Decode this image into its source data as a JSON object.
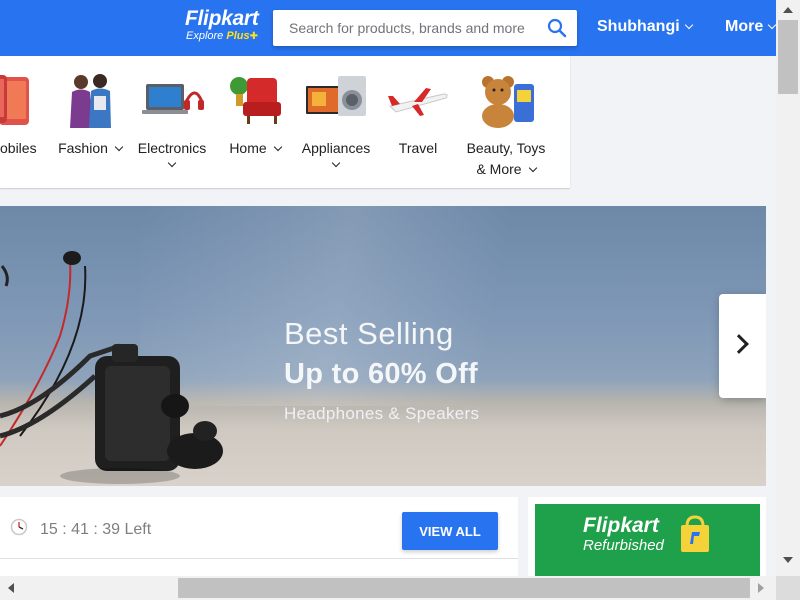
{
  "header": {
    "logo_main": "Flipkart",
    "logo_sub_prefix": "Explore",
    "logo_sub_plus": "Plus",
    "search_placeholder": "Search for products, brands and more",
    "search_icon": "search-icon",
    "user_name": "Shubhangi",
    "more_label": "More",
    "brand_color": "#2874f0",
    "plus_color": "#ffe11b"
  },
  "categories": [
    {
      "label": "Mobiles",
      "shown_text": "obiles",
      "icon": "mobile-phone-icon",
      "has_dropdown": false
    },
    {
      "label": "Fashion",
      "icon": "fashion-models-icon",
      "has_dropdown": true
    },
    {
      "label": "Electronics",
      "icon": "laptop-headphones-icon",
      "has_dropdown": true
    },
    {
      "label": "Home",
      "icon": "armchair-icon",
      "has_dropdown": true
    },
    {
      "label": "Appliances",
      "icon": "tv-washing-machine-icon",
      "has_dropdown": true
    },
    {
      "label": "Travel",
      "icon": "airplane-icon",
      "has_dropdown": false
    },
    {
      "label_line1": "Beauty, Toys",
      "label_line2": "& More",
      "icon": "teddy-bear-icon",
      "has_dropdown": true
    }
  ],
  "banner": {
    "line1": "Best Selling",
    "line2": "Up to 60% Off",
    "line3": "Headphones & Speakers",
    "next_icon": "chevron-right-icon"
  },
  "deals": {
    "timer": "15 : 41 : 39 Left",
    "timer_icon": "timer-clock-icon",
    "view_all_label": "VIEW ALL"
  },
  "refurbished": {
    "title": "Flipkart",
    "subtitle": "Refurbished",
    "icon": "shopping-bag-icon",
    "bg_color": "#1fa04a"
  }
}
